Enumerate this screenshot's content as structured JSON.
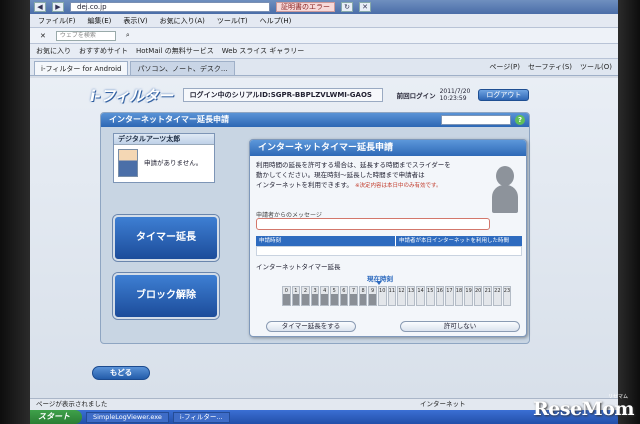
{
  "browser": {
    "address": "dej.co.jp",
    "cert_error": "証明書のエラー",
    "menu": [
      "ファイル(F)",
      "編集(E)",
      "表示(V)",
      "お気に入り(A)",
      "ツール(T)",
      "ヘルプ(H)"
    ],
    "toolbar_search_placeholder": "ウェブを検索",
    "favorites": [
      "お気に入り",
      "おすすめサイト",
      "HotMail の無料サービス",
      "Web スライス ギャラリー"
    ],
    "tabs": [
      "i-フィルター for Android",
      "パソコン、ノート、デスク..."
    ],
    "tab_tools": [
      "ページ(P)",
      "セーフティ(S)",
      "ツール(O)"
    ],
    "status_text": "ページが表示されました",
    "zone": "インターネット"
  },
  "app": {
    "brand": "i-フィルター",
    "serial": "ログイン中のシリアルID:SGPR-BBPLZVLWMI-GAOS",
    "login_time_label": "前回ログイン",
    "login_date": "2011/7/20",
    "login_time": "10:23:59",
    "logout_label": "ログアウト"
  },
  "panel": {
    "title": "インターネットタイマー延長申請",
    "help": "?",
    "user_name": "デジタルアーツ太郎",
    "user_status": "申請がありません。",
    "extend_button": "タイマー延長",
    "unblock_button": "ブロック解除",
    "back_button": "もどる"
  },
  "dialog": {
    "title": "インターネットタイマー延長申請",
    "desc_line1": "利用時間の延長を許可する場合は、延長する時間までスライダーを",
    "desc_line2": "動かしてください。現在時刻～延長した時間まで申請者は",
    "desc_line3": "インターネットを利用できます。",
    "desc_note": "※決定内容は本日中のみ有効です。",
    "message_label": "申請者からのメッセージ",
    "col_request_time": "申請時刻",
    "col_used_time": "申請者が本日インターネットを利用した時間",
    "sub_label": "インターネットタイマー延長",
    "now_label": "現在時刻",
    "hours": [
      "0",
      "1",
      "2",
      "3",
      "4",
      "5",
      "6",
      "7",
      "8",
      "9",
      "10",
      "11",
      "12",
      "13",
      "14",
      "15",
      "16",
      "17",
      "18",
      "19",
      "20",
      "21",
      "22",
      "23"
    ],
    "used_until_hour": 10,
    "approve_button": "タイマー延長をする",
    "deny_button": "許可しない"
  },
  "taskbar": {
    "start": "スタート",
    "tasks": [
      "SimpleLogViewer.exe",
      "i-フィルター..."
    ]
  },
  "watermark": {
    "text": "ReseMom",
    "sub": "リセマム"
  }
}
